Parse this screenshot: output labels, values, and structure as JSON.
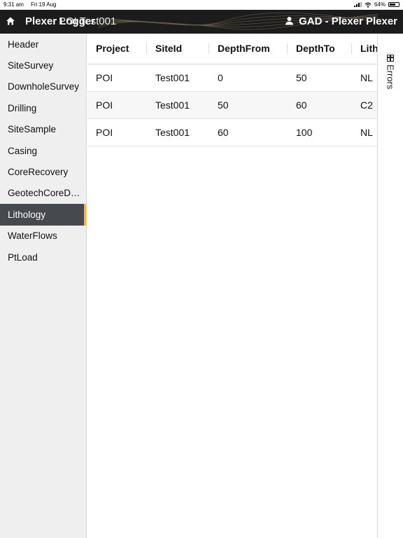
{
  "status_bar": {
    "time": "9:31 am",
    "date": "Fri 19 Aug",
    "battery": "64%"
  },
  "header": {
    "app_title": "Plexer Logger",
    "page_title": "POI Test001",
    "user_name": "GAD - Plexer Plexer",
    "icons": {
      "home": "home-icon",
      "user": "user-icon"
    }
  },
  "sidebar": {
    "items": [
      {
        "label": "Header"
      },
      {
        "label": "SiteSurvey"
      },
      {
        "label": "DownholeSurvey"
      },
      {
        "label": "Drilling"
      },
      {
        "label": "SiteSample"
      },
      {
        "label": "Casing"
      },
      {
        "label": "CoreRecovery"
      },
      {
        "label": "GeotechCoreD…"
      },
      {
        "label": "Lithology"
      },
      {
        "label": "WaterFlows"
      },
      {
        "label": "PtLoad"
      }
    ],
    "active": "Lithology",
    "accent_color": "#f2b53d"
  },
  "table": {
    "columns": [
      "Project",
      "SiteId",
      "DepthFrom",
      "DepthTo",
      "Lith"
    ],
    "rows": [
      [
        "POI",
        "Test001",
        "0",
        "50",
        "NL"
      ],
      [
        "POI",
        "Test001",
        "50",
        "60",
        "C2"
      ],
      [
        "POI",
        "Test001",
        "60",
        "100",
        "NL"
      ]
    ]
  },
  "errors_panel": {
    "label": "Errors",
    "icon": "table-icon"
  }
}
